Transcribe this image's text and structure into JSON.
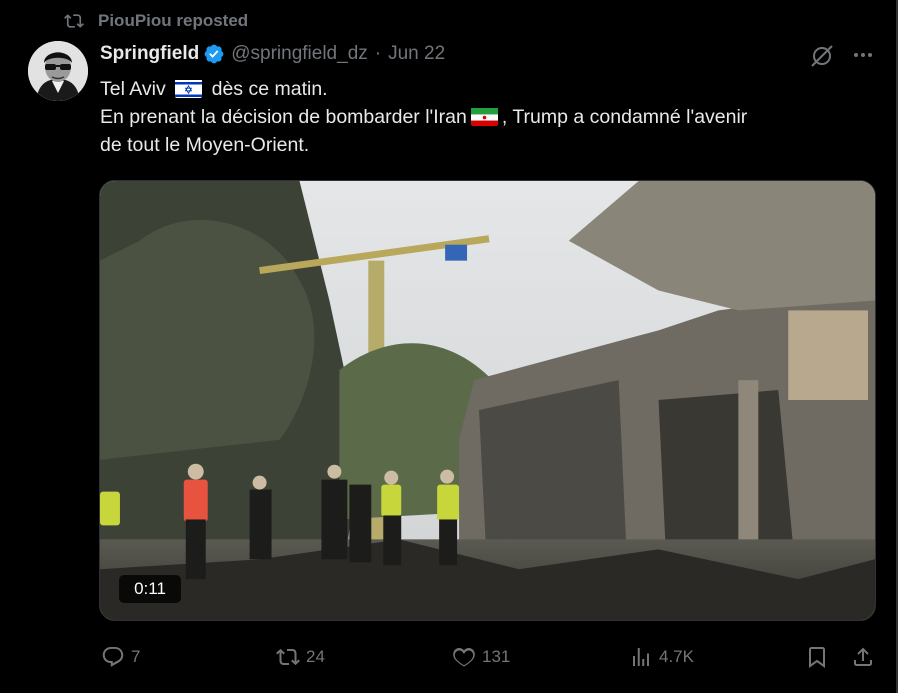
{
  "repost": {
    "icon": "repost-icon",
    "text": "PiouPiou reposted"
  },
  "author": {
    "name": "Springfield",
    "handle": "@springfield_dz",
    "separator": "·",
    "date": "Jun 22",
    "verified_color": "#1d9bf0"
  },
  "tweet": {
    "line1_a": "Tel Aviv",
    "line1_b": "dès ce matin.",
    "line2_a": "En prenant la décision de bombarder l'Iran",
    "line2_b": ", Trump a condamné l'avenir",
    "line3": "de tout le Moyen-Orient.",
    "flags": [
      "israel-flag-icon",
      "iran-flag-icon"
    ]
  },
  "media": {
    "type": "video",
    "duration": "0:11"
  },
  "actions": {
    "replies": "7",
    "reposts": "24",
    "likes": "131",
    "views": "4.7K"
  },
  "colors": {
    "background": "#000000",
    "text": "#e7e9ea",
    "muted": "#71767b",
    "accent": "#1d9bf0"
  }
}
